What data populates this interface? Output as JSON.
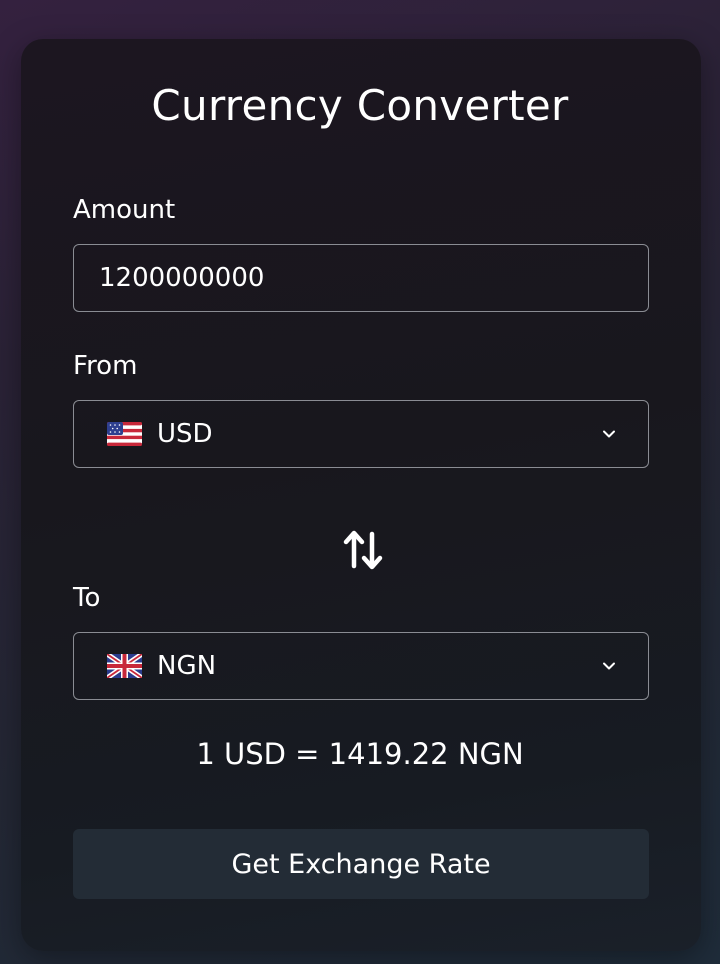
{
  "converter": {
    "title": "Currency Converter",
    "amount_label": "Amount",
    "amount_value": "1200000000",
    "from_label": "From",
    "from_currency": "USD",
    "from_flag_icon": "us-flag-icon",
    "to_label": "To",
    "to_currency": "NGN",
    "to_flag_icon": "uk-flag-icon",
    "swap_icon": "swap-arrows-icon",
    "rate_text": "1 USD = 1419.22 NGN",
    "button_label": "Get Exchange Rate"
  },
  "colors": {
    "text": "#ffffff",
    "field_border": "#8a8c93",
    "button_bg": "#232c36"
  }
}
